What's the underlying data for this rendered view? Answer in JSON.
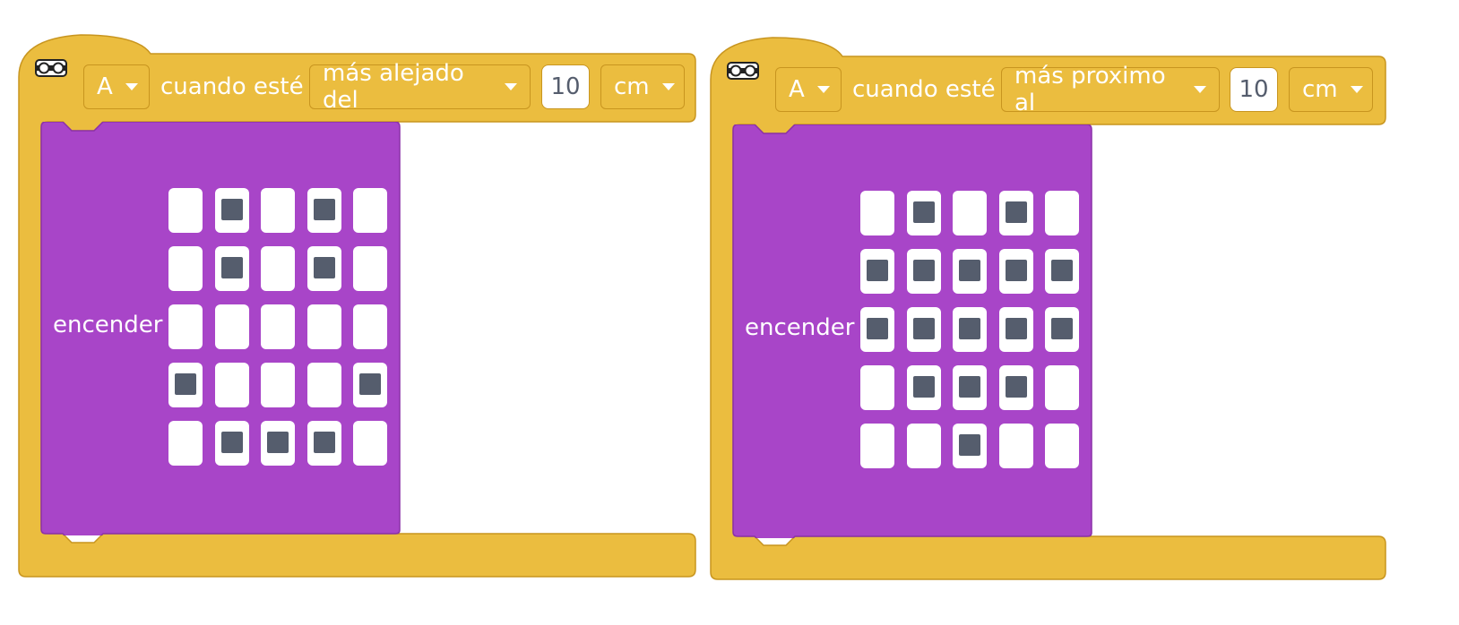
{
  "blocks": [
    {
      "port": "A",
      "connector": "cuando esté",
      "comparison": "más alejado del",
      "distance": "10",
      "unit": "cm",
      "inner_label": "encender",
      "matrix": [
        [
          0,
          1,
          0,
          1,
          0
        ],
        [
          0,
          1,
          0,
          1,
          0
        ],
        [
          0,
          0,
          0,
          0,
          0
        ],
        [
          1,
          0,
          0,
          0,
          1
        ],
        [
          0,
          1,
          1,
          1,
          0
        ]
      ]
    },
    {
      "port": "A",
      "connector": "cuando esté",
      "comparison": "más proximo al",
      "distance": "10",
      "unit": "cm",
      "inner_label": "encender",
      "matrix": [
        [
          0,
          1,
          0,
          1,
          0
        ],
        [
          1,
          1,
          1,
          1,
          1
        ],
        [
          1,
          1,
          1,
          1,
          1
        ],
        [
          0,
          1,
          1,
          1,
          0
        ],
        [
          0,
          0,
          1,
          0,
          0
        ]
      ]
    }
  ],
  "colors": {
    "event_block": "#ebbd3f",
    "event_border": "#c8951f",
    "inner_block": "#a845c8",
    "inner_border": "#8b32a8",
    "led_on": "#555d6d",
    "led_off": "#ffffff"
  },
  "icons": {
    "sensor": "ultrasonic-sensor-icon",
    "dropdown": "caret-down-icon"
  }
}
